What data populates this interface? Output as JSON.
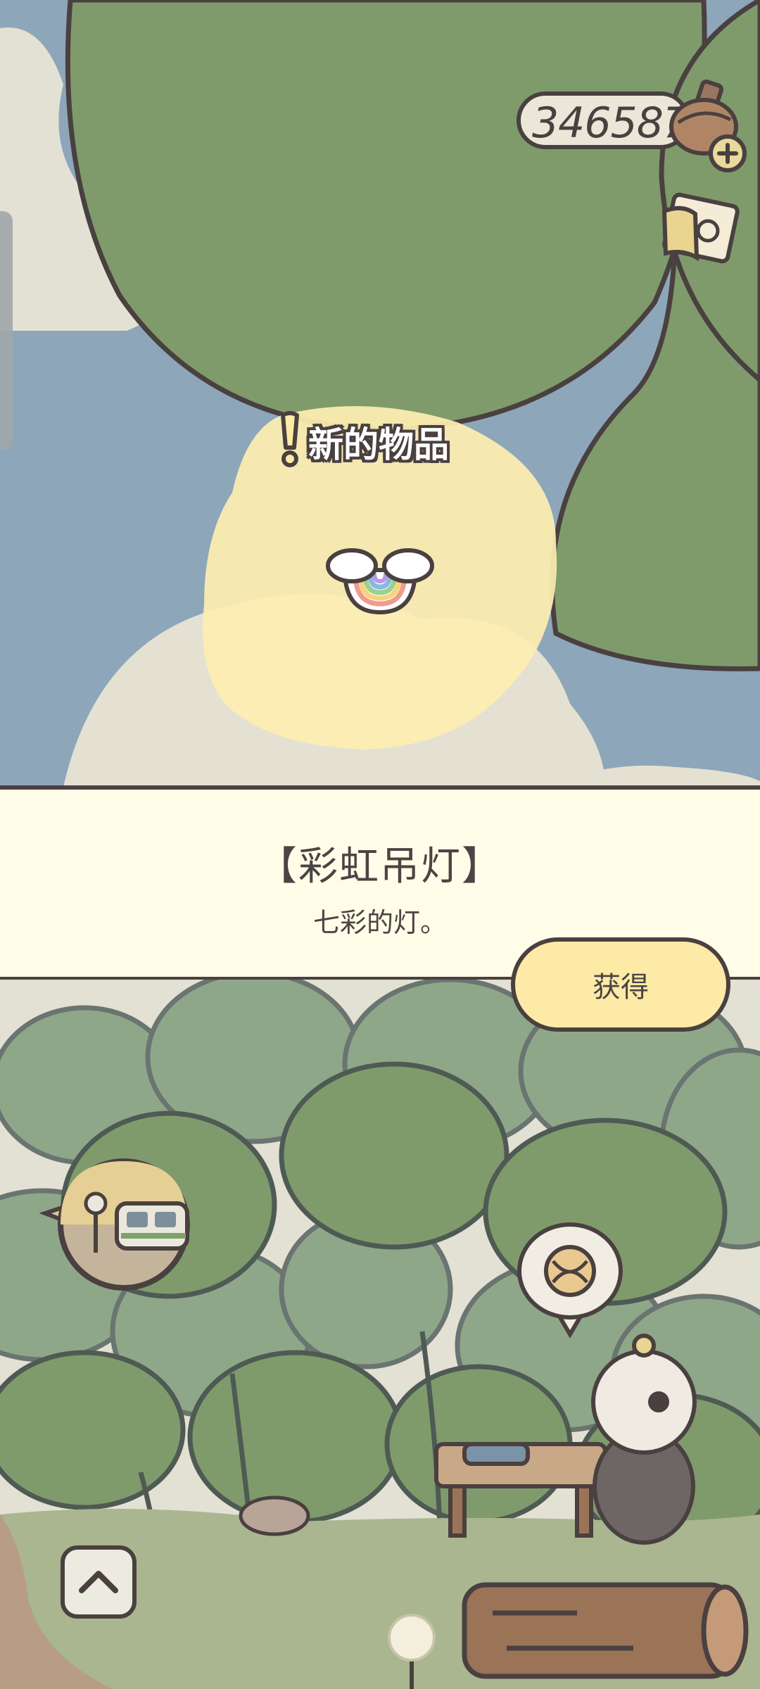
{
  "hud": {
    "currency_value": "346587",
    "currency_icon": "acorn-pot-icon",
    "add_icon": "plus-icon",
    "album_icon": "postcard-album-icon"
  },
  "reveal": {
    "badge": "!",
    "label": "新的物品",
    "item_icon": "rainbow-lamp-icon"
  },
  "item": {
    "title": "【彩虹吊灯】",
    "description": "七彩的灯。"
  },
  "actions": {
    "get_label": "获得",
    "collapse_icon": "chevron-up-icon"
  },
  "scene": {
    "bubble_left_icon": "train-bubble-icon",
    "bubble_right_icon": "yarn-ball-bubble-icon",
    "character": "sheep-craftsman",
    "flower_icon": "dandelion-icon"
  },
  "colors": {
    "sky": "#8da6ba",
    "leaf": "#7f9b6c",
    "glow": "#fdeeb0",
    "panel": "#fffde8",
    "button": "#fdeaa6",
    "outline": "#4a4040"
  }
}
